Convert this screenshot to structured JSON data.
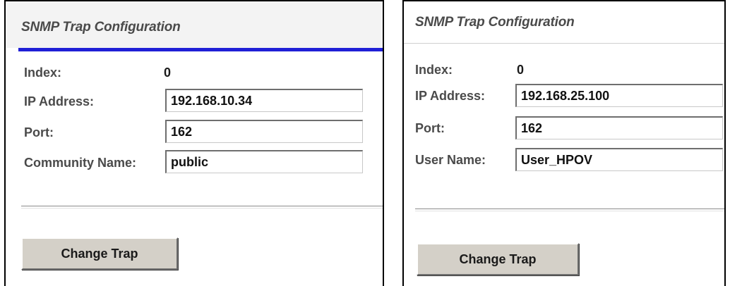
{
  "left_panel": {
    "title": "SNMP Trap Configuration",
    "index_label": "Index:",
    "index_value": "0",
    "ip_label": "IP Address:",
    "ip_value": "192.168.10.34",
    "port_label": "Port:",
    "port_value": "162",
    "community_label": "Community Name:",
    "community_value": "public",
    "button_label": "Change Trap"
  },
  "right_panel": {
    "title": "SNMP Trap Configuration",
    "index_label": "Index:",
    "index_value": "0",
    "ip_label": "IP Address:",
    "ip_value": "192.168.25.100",
    "port_label": "Port:",
    "port_value": "162",
    "user_label": "User Name:",
    "user_value": "User_HPOV",
    "button_label": "Change Trap"
  },
  "colors": {
    "accent_rule": "#1f1fd6",
    "button_face": "#d4d0c8",
    "label_text": "#4a4a4a"
  }
}
